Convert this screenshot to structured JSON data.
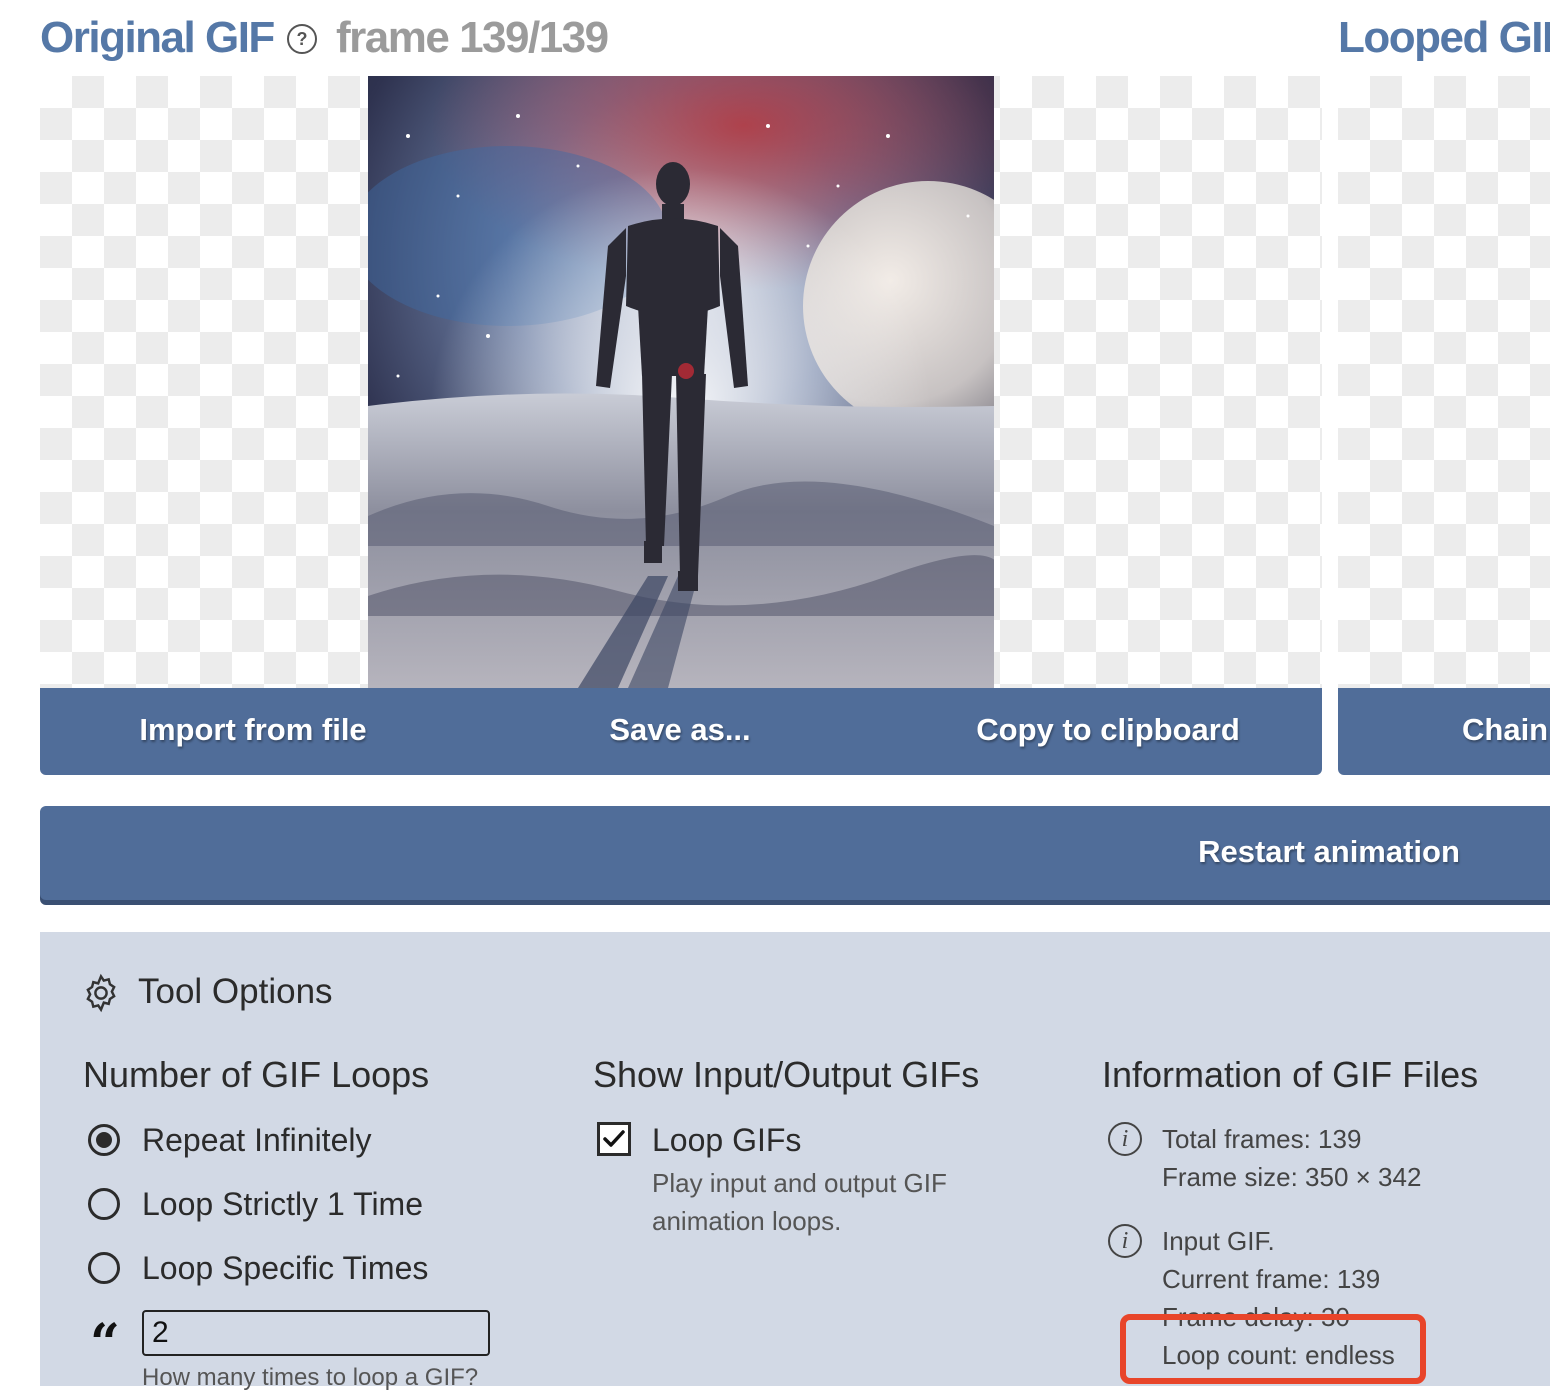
{
  "header": {
    "original_title": "Original GIF",
    "help_glyph": "?",
    "frame_counter": "frame 139/139",
    "looped_title": "Looped GIF"
  },
  "original_buttons": {
    "import_label": "Import from file",
    "save_label": "Save as...",
    "copy_label": "Copy to clipboard"
  },
  "looped_buttons": {
    "chain_label": "Chain"
  },
  "restart_label": "Restart animation",
  "tool_options": {
    "heading": "Tool Options",
    "loops": {
      "heading": "Number of GIF Loops",
      "options": [
        "Repeat Infinitely",
        "Loop Strictly 1 Time",
        "Loop Specific Times"
      ],
      "selected": "Repeat Infinitely",
      "count_value": "2",
      "count_hint": "How many times to loop a GIF?"
    },
    "show": {
      "heading": "Show Input/Output GIFs",
      "checkbox_label": "Loop GIFs",
      "checked": true,
      "description_line1": "Play input and output GIF",
      "description_line2": "animation loops."
    },
    "info": {
      "heading": "Information of GIF Files",
      "block1": {
        "line1": "Total frames: 139",
        "line2": "Frame size: 350 × 342"
      },
      "block2": {
        "line1": "Input GIF.",
        "line2": "Current frame: 139",
        "line3": "Frame delay: 30",
        "line4": "Loop count: endless"
      }
    }
  },
  "colors": {
    "accent_blue": "#506d99",
    "title_blue": "#5578a7",
    "panel_bg": "#d2d9e5",
    "highlight_red": "#e8452a"
  },
  "icons": [
    "help-circle-icon",
    "gear-icon",
    "info-icon",
    "quote-icon",
    "checkmark-icon"
  ]
}
